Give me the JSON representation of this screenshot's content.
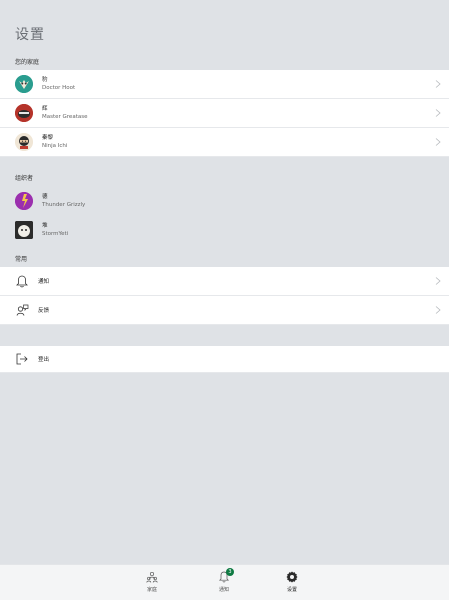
{
  "page": {
    "title": "设置"
  },
  "sections": {
    "family": {
      "label": "您的家庭"
    },
    "organizers": {
      "label": "组织者"
    },
    "common": {
      "label": "常用"
    }
  },
  "family_members": [
    {
      "name": "豹",
      "alias": "Doctor Hoot",
      "avatar_color": "#2a9d8f"
    },
    {
      "name": "辉",
      "alias": "Master Greatase",
      "avatar_color": "#b5332a"
    },
    {
      "name": "秦黎",
      "alias": "Ninja Ichi",
      "avatar_color": "#c8a87a"
    }
  ],
  "organizers": [
    {
      "name": "德",
      "alias": "Thunder Grizzly",
      "avatar_color": "#9b2fae"
    },
    {
      "name": "堆",
      "alias": "StormYeti",
      "avatar_color": "#2b2b2b"
    }
  ],
  "menu": {
    "notifications_label": "通知",
    "feedback_label": "反馈",
    "signout_label": "登出"
  },
  "tabbar": {
    "family_label": "家庭",
    "notifications_label": "通知",
    "notifications_badge": "3",
    "settings_label": "设置"
  }
}
